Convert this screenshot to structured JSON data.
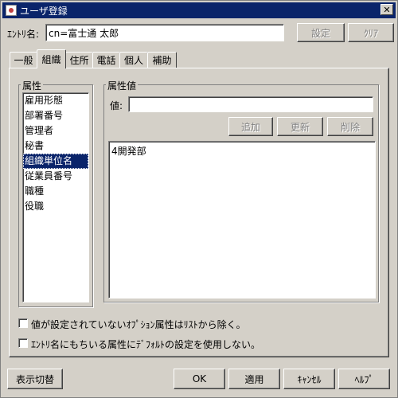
{
  "window": {
    "title": "ユーザ登録"
  },
  "entry": {
    "label": "ｴﾝﾄﾘ名:",
    "value": "cn=富士通 太郎",
    "settings_button": "設定",
    "clear_button": "ｸﾘｱ"
  },
  "tabs": [
    {
      "label": "一般"
    },
    {
      "label": "組織"
    },
    {
      "label": "住所"
    },
    {
      "label": "電話"
    },
    {
      "label": "個人"
    },
    {
      "label": "補助"
    }
  ],
  "attributes": {
    "group_title": "属性",
    "items": [
      "雇用形態",
      "部署番号",
      "管理者",
      "秘書",
      "組織単位名",
      "従業員番号",
      "職種",
      "役職"
    ],
    "selected": "組織単位名"
  },
  "attribute_values": {
    "group_title": "属性値",
    "value_label": "値:",
    "value_input": "",
    "add_button": "追加",
    "update_button": "更新",
    "delete_button": "削除",
    "values": [
      "4開発部"
    ]
  },
  "options": {
    "exclude_unset_optional": "値が設定されていないｵﾌﾟｼｮﾝ属性はﾘｽﾄから除く。",
    "no_default_settings": "ｴﾝﾄﾘ名にもちいる属性にﾃﾞﾌｫﾙﾄの設定を使用しない。"
  },
  "footer": {
    "toggle_view_button": "表示切替",
    "ok_button": "OK",
    "apply_button": "適用",
    "cancel_button": "ｷｬﾝｾﾙ",
    "help_button": "ﾍﾙﾌﾟ"
  }
}
